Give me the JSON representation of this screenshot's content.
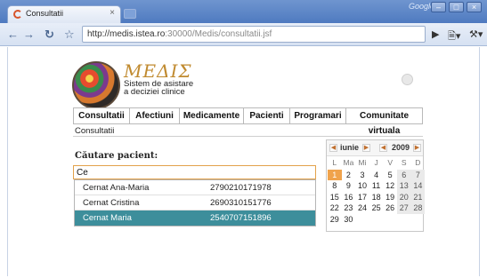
{
  "browser": {
    "tab_title": "Consultatii",
    "tab_close": "×",
    "google_label": "Google",
    "url_host": "http://medis.istea.ro",
    "url_rest": ":30000/Medis/consultatii.jsf",
    "window_minimize": "–",
    "window_maximize": "□",
    "window_close": "×"
  },
  "app": {
    "logo_title": "MEΔIΣ",
    "logo_sub_line1": "Sistem de asistare",
    "logo_sub_line2": "a deciziei clinice"
  },
  "menu": {
    "items": [
      {
        "label": "Consultatii"
      },
      {
        "label": "Afectiuni"
      },
      {
        "label": "Medicamente"
      },
      {
        "label": "Pacienti"
      },
      {
        "label": "Programari"
      },
      {
        "label": "Comunitate virtuala"
      }
    ]
  },
  "breadcrumb": "Consultatii",
  "search": {
    "label": "Căutare pacient:",
    "value": "Ce"
  },
  "suggestions": [
    {
      "name": "Cernat Ana-Maria",
      "cnp": "2790210171978",
      "selected": false
    },
    {
      "name": "Cernat Cristina",
      "cnp": "2690310151776",
      "selected": false
    },
    {
      "name": "Cernat Maria",
      "cnp": "2540707151896",
      "selected": true
    }
  ],
  "calendar": {
    "month": "iunie",
    "year": "2009",
    "weekdays": [
      "L",
      "Ma",
      "Mi",
      "J",
      "V",
      "S",
      "D"
    ],
    "days": [
      [
        "1",
        "2",
        "3",
        "4",
        "5",
        "6",
        "7"
      ],
      [
        "8",
        "9",
        "10",
        "11",
        "12",
        "13",
        "14"
      ],
      [
        "15",
        "16",
        "17",
        "18",
        "19",
        "20",
        "21"
      ],
      [
        "22",
        "23",
        "24",
        "25",
        "26",
        "27",
        "28"
      ],
      [
        "29",
        "30",
        "",
        "",
        "",
        "",
        ""
      ]
    ],
    "today": "1",
    "accent_color": "#f0a34c"
  },
  "colors": {
    "selected_row": "#3d8e9b",
    "input_border": "#e3a24b"
  }
}
